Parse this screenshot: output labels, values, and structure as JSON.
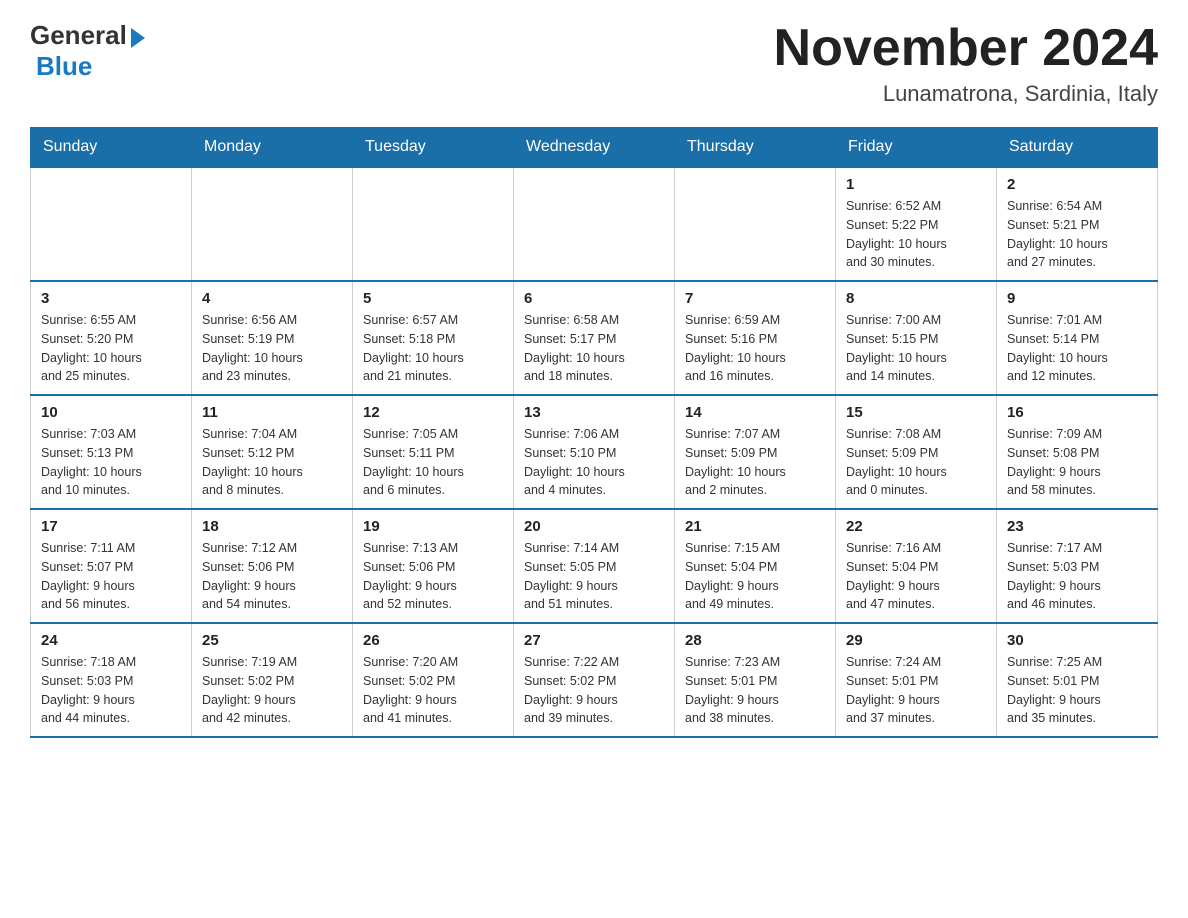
{
  "header": {
    "logo": {
      "general": "General",
      "blue": "Blue",
      "subtitle": "Blue"
    },
    "title": "November 2024",
    "location": "Lunamatrona, Sardinia, Italy"
  },
  "weekdays": [
    "Sunday",
    "Monday",
    "Tuesday",
    "Wednesday",
    "Thursday",
    "Friday",
    "Saturday"
  ],
  "weeks": [
    [
      {
        "day": "",
        "info": ""
      },
      {
        "day": "",
        "info": ""
      },
      {
        "day": "",
        "info": ""
      },
      {
        "day": "",
        "info": ""
      },
      {
        "day": "",
        "info": ""
      },
      {
        "day": "1",
        "info": "Sunrise: 6:52 AM\nSunset: 5:22 PM\nDaylight: 10 hours\nand 30 minutes."
      },
      {
        "day": "2",
        "info": "Sunrise: 6:54 AM\nSunset: 5:21 PM\nDaylight: 10 hours\nand 27 minutes."
      }
    ],
    [
      {
        "day": "3",
        "info": "Sunrise: 6:55 AM\nSunset: 5:20 PM\nDaylight: 10 hours\nand 25 minutes."
      },
      {
        "day": "4",
        "info": "Sunrise: 6:56 AM\nSunset: 5:19 PM\nDaylight: 10 hours\nand 23 minutes."
      },
      {
        "day": "5",
        "info": "Sunrise: 6:57 AM\nSunset: 5:18 PM\nDaylight: 10 hours\nand 21 minutes."
      },
      {
        "day": "6",
        "info": "Sunrise: 6:58 AM\nSunset: 5:17 PM\nDaylight: 10 hours\nand 18 minutes."
      },
      {
        "day": "7",
        "info": "Sunrise: 6:59 AM\nSunset: 5:16 PM\nDaylight: 10 hours\nand 16 minutes."
      },
      {
        "day": "8",
        "info": "Sunrise: 7:00 AM\nSunset: 5:15 PM\nDaylight: 10 hours\nand 14 minutes."
      },
      {
        "day": "9",
        "info": "Sunrise: 7:01 AM\nSunset: 5:14 PM\nDaylight: 10 hours\nand 12 minutes."
      }
    ],
    [
      {
        "day": "10",
        "info": "Sunrise: 7:03 AM\nSunset: 5:13 PM\nDaylight: 10 hours\nand 10 minutes."
      },
      {
        "day": "11",
        "info": "Sunrise: 7:04 AM\nSunset: 5:12 PM\nDaylight: 10 hours\nand 8 minutes."
      },
      {
        "day": "12",
        "info": "Sunrise: 7:05 AM\nSunset: 5:11 PM\nDaylight: 10 hours\nand 6 minutes."
      },
      {
        "day": "13",
        "info": "Sunrise: 7:06 AM\nSunset: 5:10 PM\nDaylight: 10 hours\nand 4 minutes."
      },
      {
        "day": "14",
        "info": "Sunrise: 7:07 AM\nSunset: 5:09 PM\nDaylight: 10 hours\nand 2 minutes."
      },
      {
        "day": "15",
        "info": "Sunrise: 7:08 AM\nSunset: 5:09 PM\nDaylight: 10 hours\nand 0 minutes."
      },
      {
        "day": "16",
        "info": "Sunrise: 7:09 AM\nSunset: 5:08 PM\nDaylight: 9 hours\nand 58 minutes."
      }
    ],
    [
      {
        "day": "17",
        "info": "Sunrise: 7:11 AM\nSunset: 5:07 PM\nDaylight: 9 hours\nand 56 minutes."
      },
      {
        "day": "18",
        "info": "Sunrise: 7:12 AM\nSunset: 5:06 PM\nDaylight: 9 hours\nand 54 minutes."
      },
      {
        "day": "19",
        "info": "Sunrise: 7:13 AM\nSunset: 5:06 PM\nDaylight: 9 hours\nand 52 minutes."
      },
      {
        "day": "20",
        "info": "Sunrise: 7:14 AM\nSunset: 5:05 PM\nDaylight: 9 hours\nand 51 minutes."
      },
      {
        "day": "21",
        "info": "Sunrise: 7:15 AM\nSunset: 5:04 PM\nDaylight: 9 hours\nand 49 minutes."
      },
      {
        "day": "22",
        "info": "Sunrise: 7:16 AM\nSunset: 5:04 PM\nDaylight: 9 hours\nand 47 minutes."
      },
      {
        "day": "23",
        "info": "Sunrise: 7:17 AM\nSunset: 5:03 PM\nDaylight: 9 hours\nand 46 minutes."
      }
    ],
    [
      {
        "day": "24",
        "info": "Sunrise: 7:18 AM\nSunset: 5:03 PM\nDaylight: 9 hours\nand 44 minutes."
      },
      {
        "day": "25",
        "info": "Sunrise: 7:19 AM\nSunset: 5:02 PM\nDaylight: 9 hours\nand 42 minutes."
      },
      {
        "day": "26",
        "info": "Sunrise: 7:20 AM\nSunset: 5:02 PM\nDaylight: 9 hours\nand 41 minutes."
      },
      {
        "day": "27",
        "info": "Sunrise: 7:22 AM\nSunset: 5:02 PM\nDaylight: 9 hours\nand 39 minutes."
      },
      {
        "day": "28",
        "info": "Sunrise: 7:23 AM\nSunset: 5:01 PM\nDaylight: 9 hours\nand 38 minutes."
      },
      {
        "day": "29",
        "info": "Sunrise: 7:24 AM\nSunset: 5:01 PM\nDaylight: 9 hours\nand 37 minutes."
      },
      {
        "day": "30",
        "info": "Sunrise: 7:25 AM\nSunset: 5:01 PM\nDaylight: 9 hours\nand 35 minutes."
      }
    ]
  ]
}
